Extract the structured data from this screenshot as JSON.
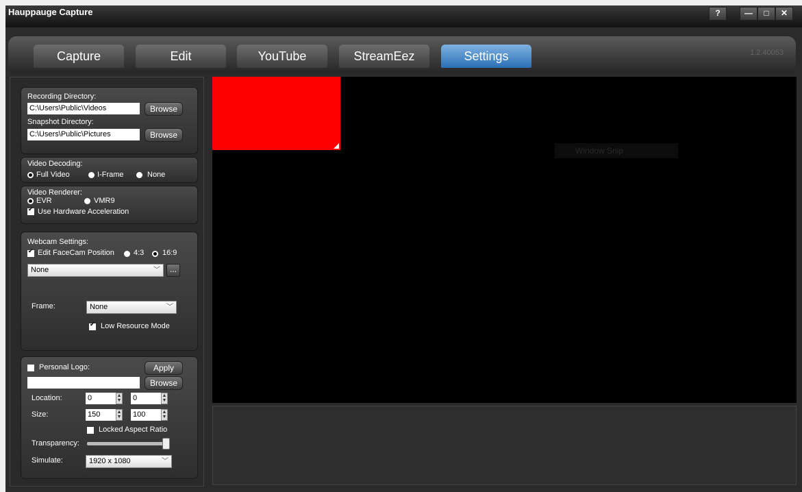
{
  "window": {
    "title": "Hauppauge Capture",
    "help_label": "?",
    "minimize_label": "—",
    "maximize_label": "□",
    "close_label": "✕"
  },
  "tabs": [
    {
      "label": "Capture"
    },
    {
      "label": "Edit"
    },
    {
      "label": "YouTube"
    },
    {
      "label": "StreamEez"
    },
    {
      "label": "Settings"
    }
  ],
  "active_tab": "Settings",
  "version": "1.2.40053",
  "directories": {
    "recording_label": "Recording Directory:",
    "recording_value": "C:\\Users\\Public\\Videos",
    "snapshot_label": "Snapshot Directory:",
    "snapshot_value": "C:\\Users\\Public\\Pictures",
    "browse_label": "Browse"
  },
  "video_decoding": {
    "label": "Video Decoding:",
    "options": [
      "Full Video",
      "I-Frame",
      "None"
    ],
    "selected": "Full Video"
  },
  "video_renderer": {
    "label": "Video Renderer:",
    "options": [
      "EVR",
      "VMR9"
    ],
    "selected": "EVR",
    "hw_accel_label": "Use Hardware Acceleration",
    "hw_accel_checked": true
  },
  "webcam": {
    "label": "Webcam Settings:",
    "edit_facecam_label": "Edit FaceCam Position",
    "edit_facecam_checked": true,
    "ratio_options": [
      "4:3",
      "16:9"
    ],
    "ratio_selected": "16:9",
    "device_value": "None",
    "more_label": "...",
    "frame_label": "Frame:",
    "frame_value": "None",
    "low_resource_label": "Low Resource Mode",
    "low_resource_checked": true
  },
  "logo": {
    "personal_logo_label": "Personal Logo:",
    "personal_logo_checked": false,
    "apply_label": "Apply",
    "browse_label": "Browse",
    "path_value": "",
    "location_label": "Location:",
    "location_x": "0",
    "location_y": "0",
    "size_label": "Size:",
    "size_w": "150",
    "size_h": "100",
    "locked_aspect_label": "Locked Aspect Ratio",
    "locked_aspect_checked": false,
    "transparency_label": "Transparency:",
    "transparency_value": 1.0,
    "simulate_label": "Simulate:",
    "simulate_value": "1920 x 1080"
  },
  "preview": {
    "overlay_text": "Window Snip"
  },
  "colors": {
    "accent_tab": "#3a7fc4",
    "facecam_box": "#ff0000",
    "preview_bg": "#000000"
  }
}
